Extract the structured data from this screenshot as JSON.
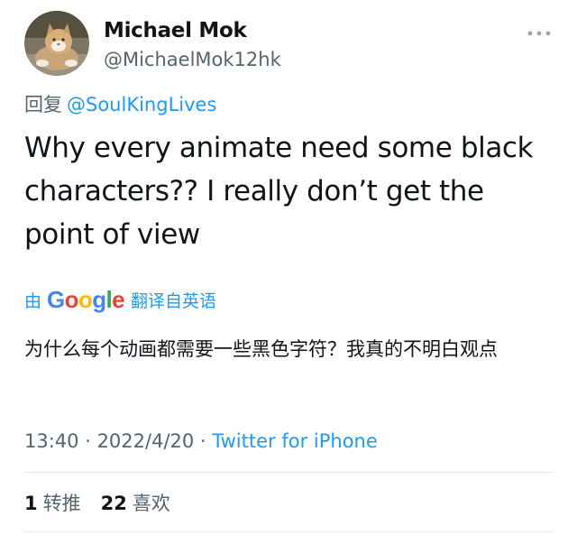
{
  "author": {
    "display_name": "Michael Mok",
    "handle": "@MichaelMok12hk"
  },
  "reply": {
    "prefix": "回复",
    "target": "@SoulKingLives"
  },
  "tweet": {
    "text": "Why every animate need some black characters?? I really don’t get the point of view"
  },
  "translation": {
    "prefix": "由",
    "provider_letters": [
      "G",
      "o",
      "o",
      "g",
      "l",
      "e"
    ],
    "suffix": "翻译自英语",
    "text": "为什么每个动画都需要一些黑色字符？我真的不明白观点"
  },
  "meta": {
    "time": "13:40",
    "date": "2022/4/20",
    "separator": " · ",
    "source": "Twitter for iPhone"
  },
  "stats": {
    "retweets_count": "1",
    "retweets_label": "转推",
    "likes_count": "22",
    "likes_label": "喜欢"
  },
  "icons": {
    "more": "more-horizontal-icon",
    "avatar": "avatar-cat-photo"
  },
  "colors": {
    "link": "#1d9bf0",
    "secondary_text": "#536471",
    "primary_text": "#0f1419",
    "divider": "#e4e8eb"
  }
}
